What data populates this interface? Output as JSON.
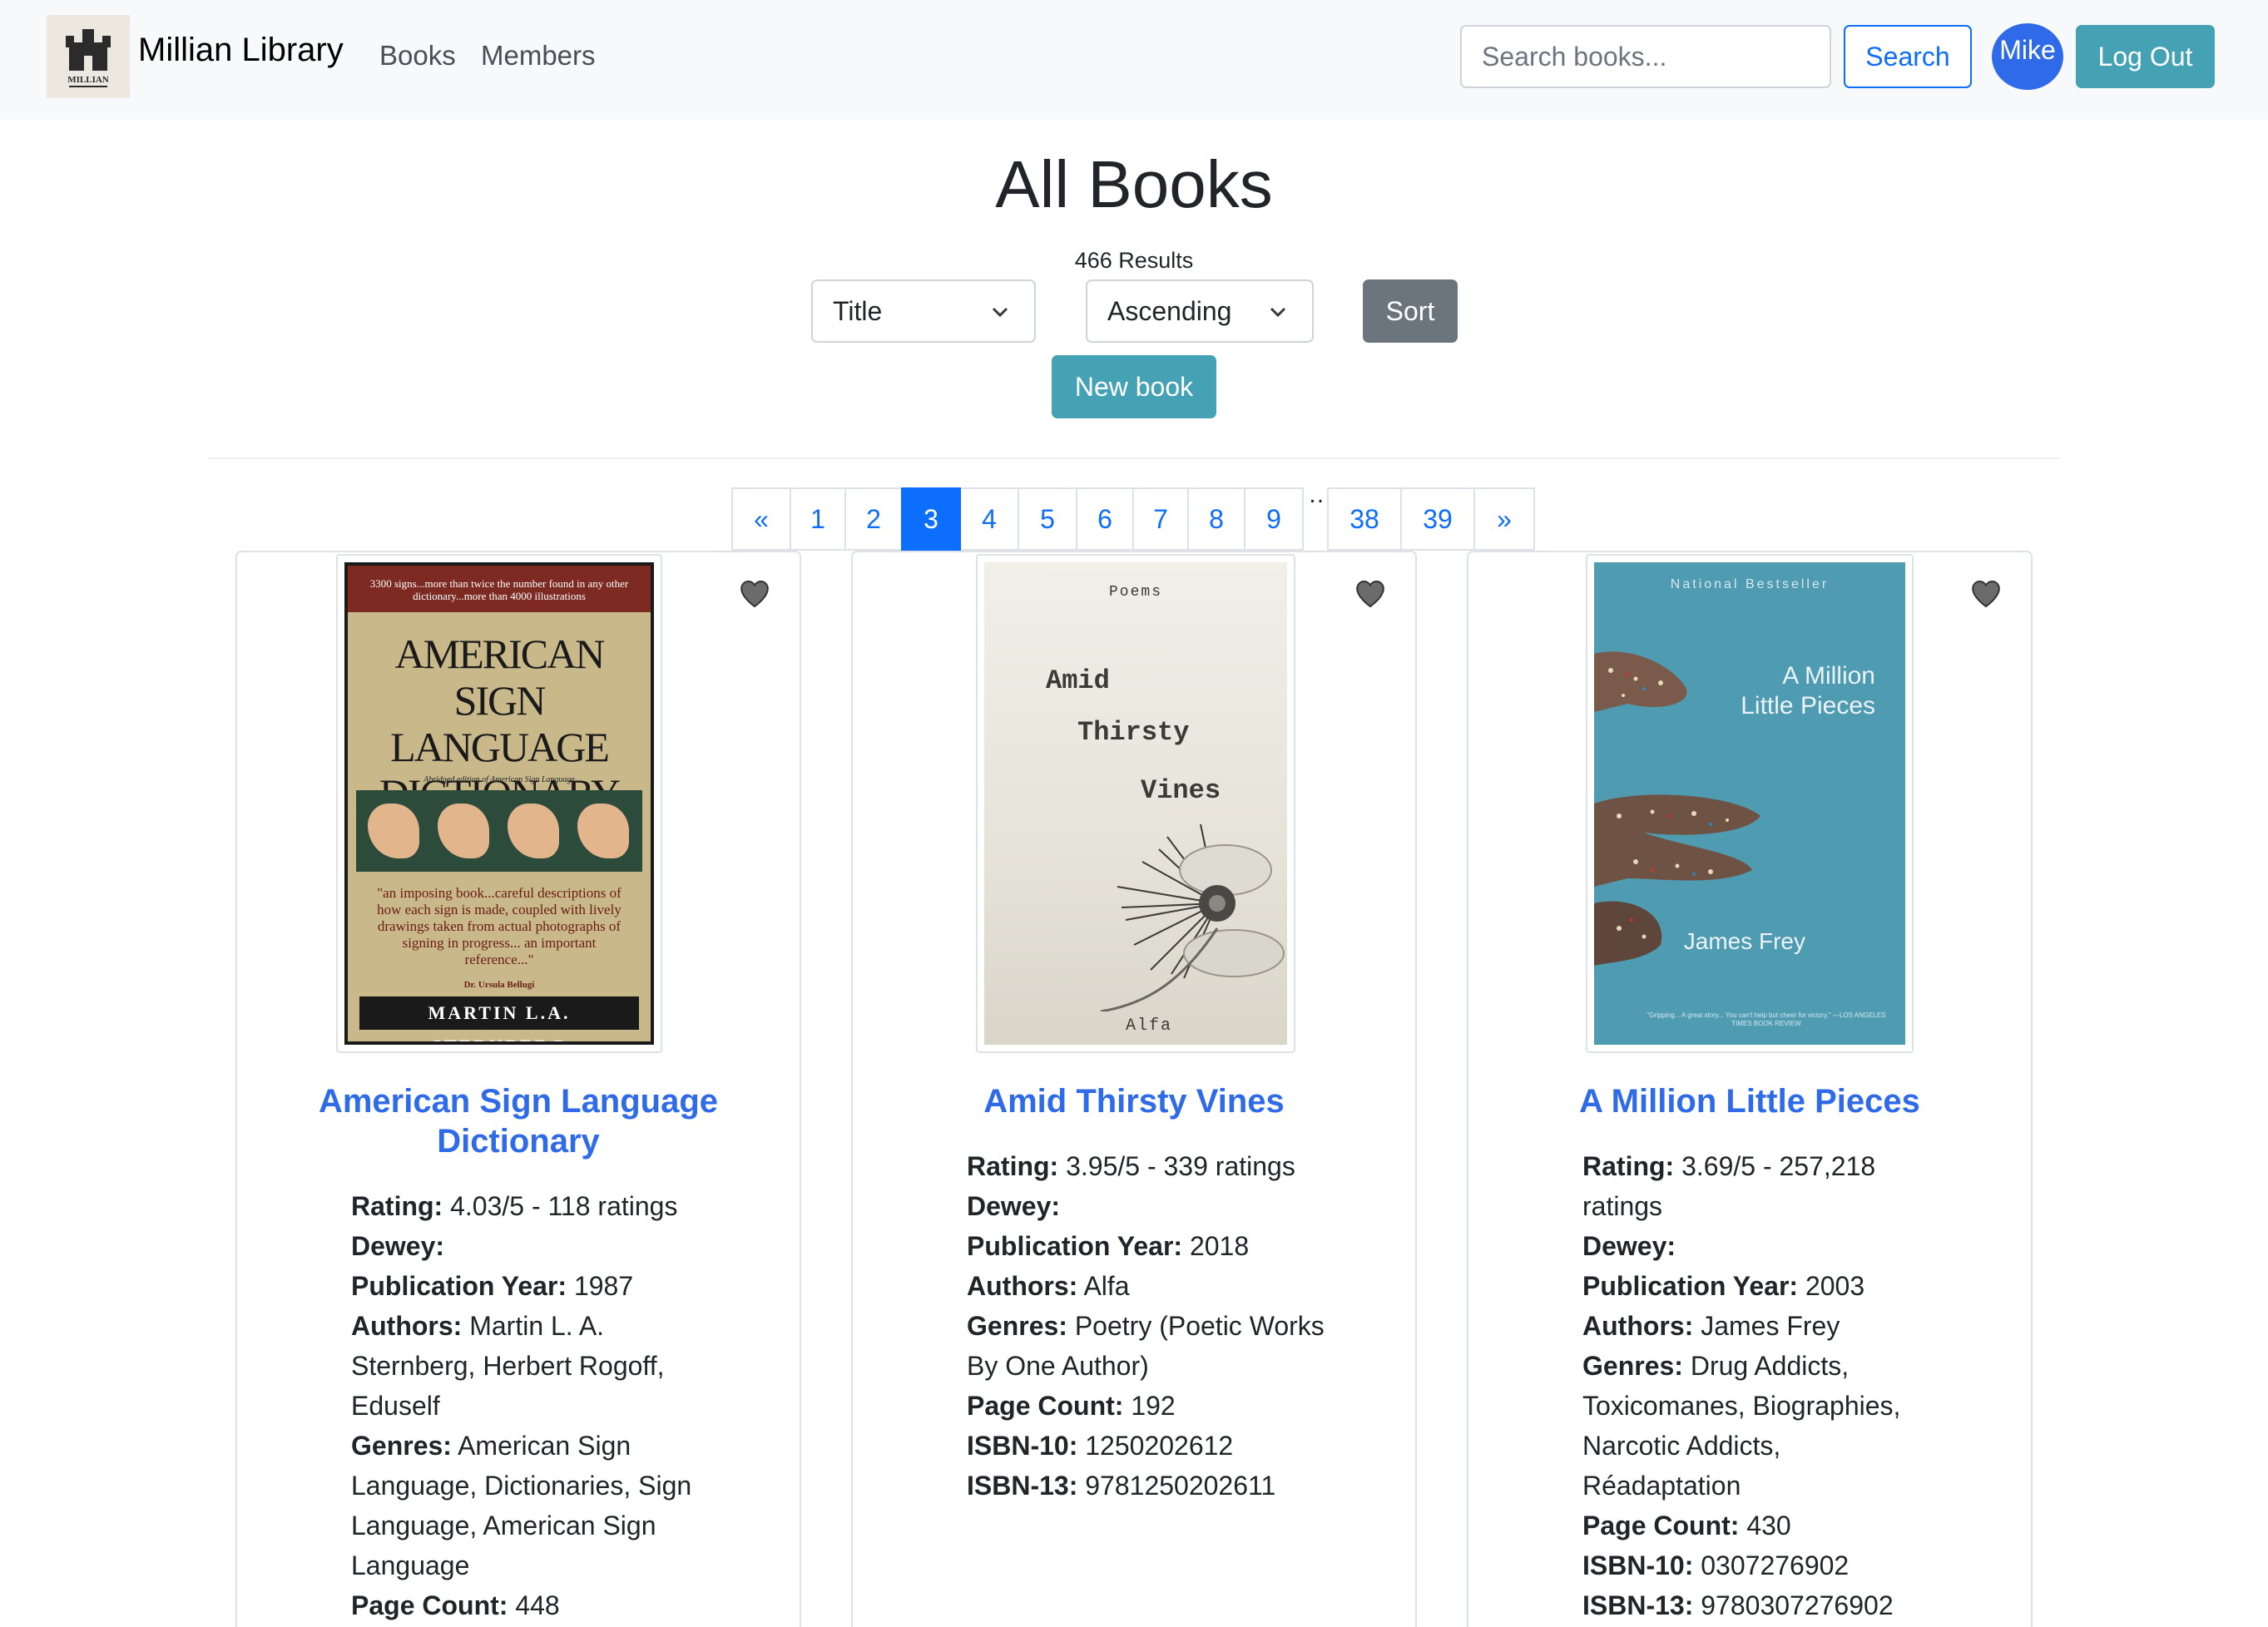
{
  "navbar": {
    "brand": "Millian Library",
    "logo_text": "MILLIAN",
    "links": [
      "Books",
      "Members"
    ],
    "search_placeholder": "Search books...",
    "search_button": "Search",
    "user_initial": "Mike",
    "logout_button": "Log Out"
  },
  "header": {
    "title": "All Books",
    "results": "466 Results",
    "sort_field": "Title",
    "sort_order": "Ascending",
    "sort_button": "Sort",
    "new_book_button": "New book"
  },
  "pagination": {
    "prev": "«",
    "pages": [
      "1",
      "2",
      "3",
      "4",
      "5",
      "6",
      "7",
      "8",
      "9"
    ],
    "ellipsis": "…",
    "tail_pages": [
      "38",
      "39"
    ],
    "next": "»",
    "active_page": "3"
  },
  "books": [
    {
      "title": "American Sign Language Dictionary",
      "rating_label": "Rating:",
      "rating": "4.03/5 - 118 ratings",
      "dewey_label": "Dewey:",
      "dewey": "",
      "year_label": "Publication Year:",
      "year": "1987",
      "authors_label": "Authors:",
      "authors": "Martin L. A. Sternberg, Herbert Rogoff, Eduself",
      "genres_label": "Genres:",
      "genres": "American Sign Language, Dictionaries, Sign Language, American Sign Language",
      "pages_label": "Page Count:",
      "pages": "448",
      "cover": {
        "top_text": "3300 signs...more than twice the number found in any other dictionary...more than 4000 illustrations",
        "title": "AMERICAN SIGN LANGUAGE DICTIONARY",
        "subtitle": "Abridged edition of American Sign Language",
        "quote": "\"an imposing book...careful descriptions of how each sign is made, coupled with lively drawings taken from actual photographs of signing in progress... an important reference...\"",
        "quote_by": "Dr. Ursula Bellugi",
        "author": "MARTIN L.A. STERNBERG"
      }
    },
    {
      "title": "Amid Thirsty Vines",
      "rating_label": "Rating:",
      "rating": "3.95/5 - 339 ratings",
      "dewey_label": "Dewey:",
      "dewey": "",
      "year_label": "Publication Year:",
      "year": "2018",
      "authors_label": "Authors:",
      "authors": "Alfa",
      "genres_label": "Genres:",
      "genres": "Poetry (Poetic Works By One Author)",
      "pages_label": "Page Count:",
      "pages": "192",
      "isbn10_label": "ISBN-10:",
      "isbn10": "1250202612",
      "isbn13_label": "ISBN-13:",
      "isbn13": "9781250202611",
      "cover": {
        "kicker": "Poems",
        "line1": "Amid",
        "line2": "Thirsty",
        "line3": "Vines",
        "author": "Alfa"
      }
    },
    {
      "title": "A Million Little Pieces",
      "rating_label": "Rating:",
      "rating": "3.69/5 - 257,218 ratings",
      "dewey_label": "Dewey:",
      "dewey": "",
      "year_label": "Publication Year:",
      "year": "2003",
      "authors_label": "Authors:",
      "authors": "James Frey",
      "genres_label": "Genres:",
      "genres": "Drug Addicts, Toxicomanes, Biographies, Narcotic Addicts, Réadaptation",
      "pages_label": "Page Count:",
      "pages": "430",
      "isbn10_label": "ISBN-10:",
      "isbn10": "0307276902",
      "isbn13_label": "ISBN-13:",
      "isbn13": "9780307276902",
      "cover": {
        "kicker": "National Bestseller",
        "line1": "A Million",
        "line2": "Little Pieces",
        "author": "James Frey",
        "blurb": "\"Gripping... A great story... You can't help but cheer for victory.\" —LOS ANGELES TIMES BOOK REVIEW"
      }
    }
  ],
  "colors": {
    "primary": "#0d6efd",
    "info": "#45a2b5",
    "secondary": "#6c757d",
    "link": "#2f6be9"
  }
}
